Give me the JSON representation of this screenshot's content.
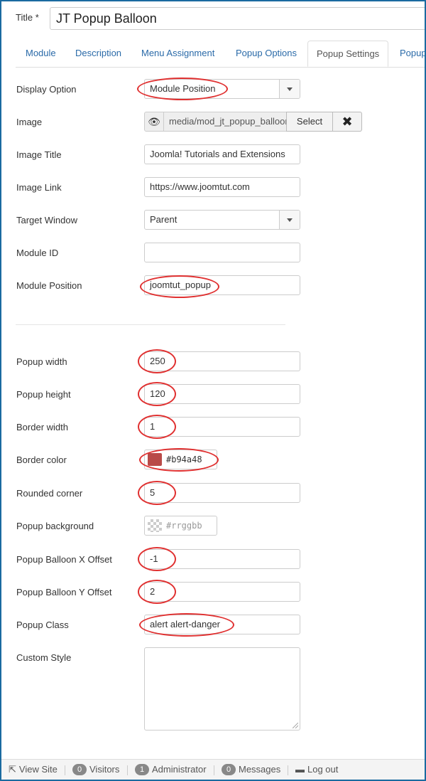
{
  "title": {
    "label": "Title *",
    "value": "JT Popup Balloon"
  },
  "tabs": [
    {
      "label": "Module"
    },
    {
      "label": "Description"
    },
    {
      "label": "Menu Assignment"
    },
    {
      "label": "Popup Options"
    },
    {
      "label": "Popup Settings",
      "active": true
    },
    {
      "label": "Popup"
    }
  ],
  "form": {
    "display_option": {
      "label": "Display Option",
      "value": "Module Position"
    },
    "image": {
      "label": "Image",
      "path": "media/mod_jt_popup_balloon",
      "select_label": "Select",
      "clear_label": "✖"
    },
    "image_title": {
      "label": "Image Title",
      "value": "Joomla! Tutorials and Extensions"
    },
    "image_link": {
      "label": "Image Link",
      "value": "https://www.joomtut.com"
    },
    "target_window": {
      "label": "Target Window",
      "value": "Parent"
    },
    "module_id": {
      "label": "Module ID",
      "value": ""
    },
    "module_position": {
      "label": "Module Position",
      "value": "joomtut_popup"
    },
    "popup_width": {
      "label": "Popup width",
      "value": "250"
    },
    "popup_height": {
      "label": "Popup height",
      "value": "120"
    },
    "border_width": {
      "label": "Border width",
      "value": "1"
    },
    "border_color": {
      "label": "Border color",
      "value": "#b94a48",
      "swatch": "#b94a48"
    },
    "rounded_corner": {
      "label": "Rounded corner",
      "value": "5"
    },
    "popup_background": {
      "label": "Popup background",
      "placeholder": "#rrggbb"
    },
    "x_offset": {
      "label": "Popup Balloon X Offset",
      "value": "-1"
    },
    "y_offset": {
      "label": "Popup Balloon Y Offset",
      "value": "2"
    },
    "popup_class": {
      "label": "Popup Class",
      "value": "alert alert-danger"
    },
    "custom_style": {
      "label": "Custom Style",
      "value": ""
    }
  },
  "statusbar": {
    "view_site": "View Site",
    "visitors_count": "0",
    "visitors_label": "Visitors",
    "admin_count": "1",
    "admin_label": "Administrator",
    "messages_count": "0",
    "messages_label": "Messages",
    "logout_label": "Log out"
  },
  "colors": {
    "accent": "#2a6aa8",
    "annotation": "#e03030",
    "frame": "#1a6aa0"
  }
}
